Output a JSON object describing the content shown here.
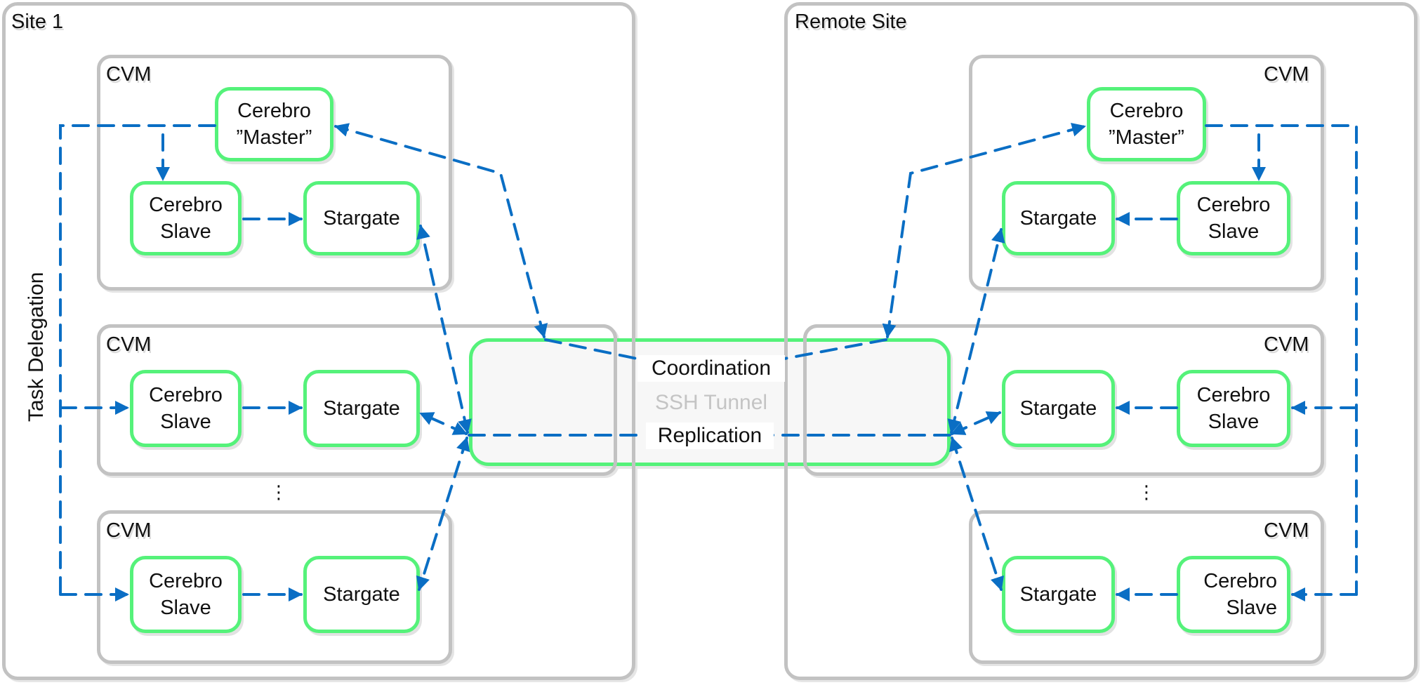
{
  "sites": {
    "left": {
      "title": "Site 1"
    },
    "right": {
      "title": "Remote Site"
    }
  },
  "cvm_label": "CVM",
  "services": {
    "master_line1": "Cerebro",
    "master_line2": "”Master”",
    "slave_line1": "Cerebro",
    "slave_line2": "Slave",
    "stargate": "Stargate"
  },
  "left_annotation": "Task Delegation",
  "ellipsis": "⋮",
  "tunnel": {
    "coordination": "Coordination",
    "ssh": "SSH Tunnel",
    "replication": "Replication"
  },
  "colors": {
    "service_border": "#55f27a",
    "container_border": "#c2c2c2",
    "arrow": "#0a6ec4",
    "muted_text": "#c4c4c4"
  }
}
